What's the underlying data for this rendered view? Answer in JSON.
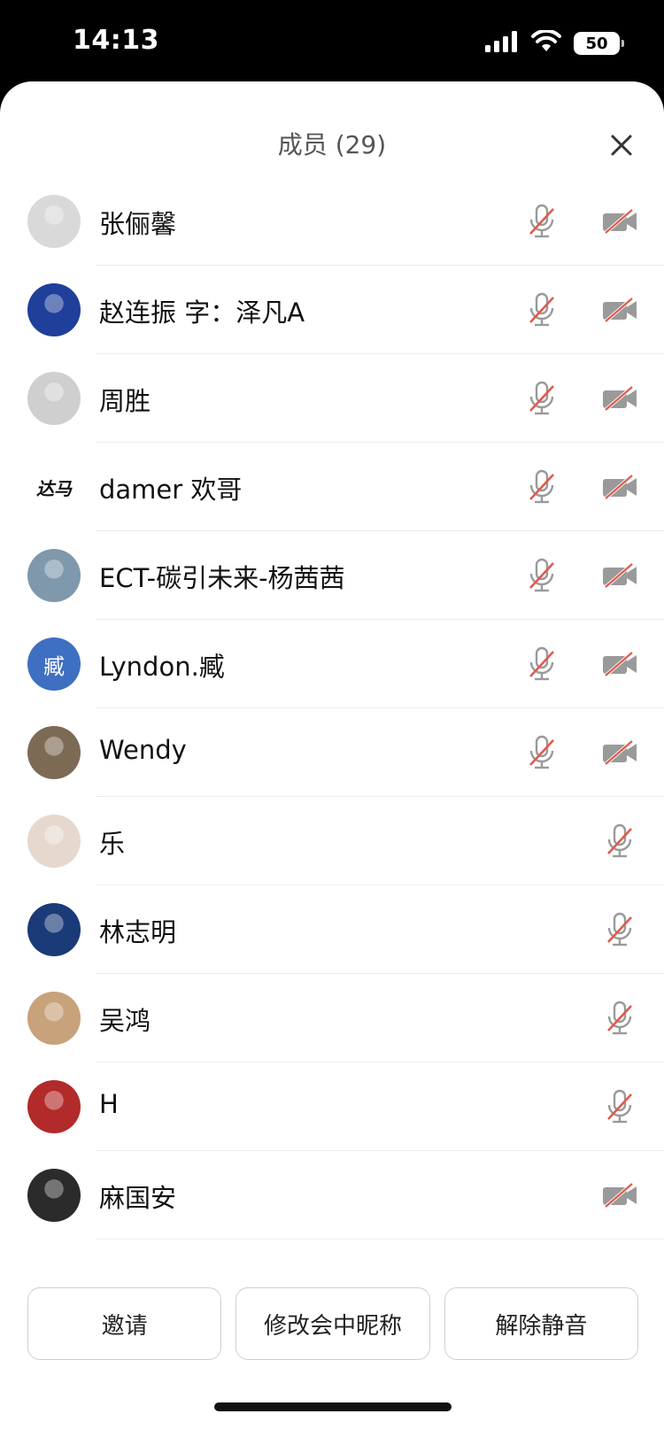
{
  "status": {
    "time": "14:13",
    "battery": "50"
  },
  "sheet": {
    "title": "成员 (29)"
  },
  "members": [
    {
      "name": "张俪馨",
      "avatar": "photo",
      "avatar_color": "#d9d9d9",
      "mic": "muted",
      "camera": "off"
    },
    {
      "name": "赵连振  字：泽凡A",
      "avatar": "photo",
      "avatar_color": "#1e3f9a",
      "mic": "muted",
      "camera": "off"
    },
    {
      "name": "周胜",
      "avatar": "photo",
      "avatar_color": "#cfcfcf",
      "mic": "muted",
      "camera": "off"
    },
    {
      "name": "damer 欢哥",
      "avatar": "logo",
      "avatar_text": "达马",
      "avatar_color": "#ffffff",
      "mic": "muted",
      "camera": "off"
    },
    {
      "name": "ECT-碳引未来-杨茜茜",
      "avatar": "photo",
      "avatar_color": "#7f98ab",
      "mic": "muted",
      "camera": "off"
    },
    {
      "name": "Lyndon.臧",
      "avatar": "text",
      "avatar_text": "臧",
      "avatar_color": "#3f6fc0",
      "mic": "muted",
      "camera": "off"
    },
    {
      "name": "Wendy",
      "avatar": "photo",
      "avatar_color": "#7d6a54",
      "mic": "muted",
      "camera": "off"
    },
    {
      "name": "乐",
      "avatar": "photo",
      "avatar_color": "#e6d8cf",
      "mic": "muted",
      "camera": "none"
    },
    {
      "name": "林志明",
      "avatar": "photo",
      "avatar_color": "#1a3b78",
      "mic": "muted",
      "camera": "none"
    },
    {
      "name": "吴鸿",
      "avatar": "photo",
      "avatar_color": "#c7a27a",
      "mic": "muted",
      "camera": "none"
    },
    {
      "name": "H",
      "avatar": "photo",
      "avatar_color": "#b32a2a",
      "mic": "muted",
      "camera": "none"
    },
    {
      "name": "麻国安",
      "avatar": "photo",
      "avatar_color": "#2b2b2b",
      "mic": "none",
      "camera": "off"
    }
  ],
  "actions": {
    "invite": "邀请",
    "rename": "修改会中昵称",
    "unmute": "解除静音"
  },
  "colors": {
    "mute_slash": "#e05a4e",
    "icon_gray": "#9a9a9a"
  }
}
